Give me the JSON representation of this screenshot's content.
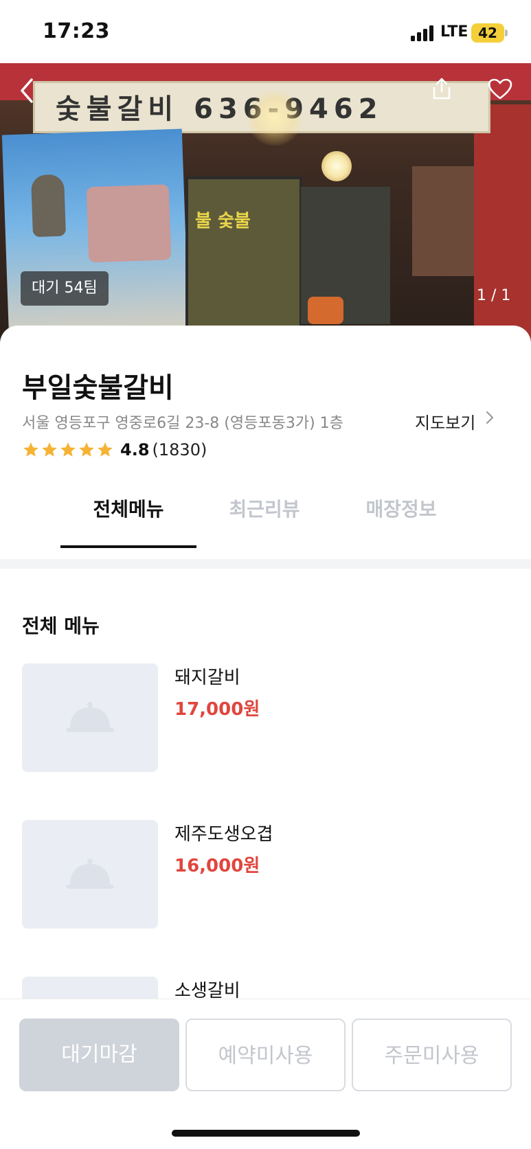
{
  "status_bar": {
    "time": "17:23",
    "network": "LTE",
    "battery": "42"
  },
  "hero": {
    "sign_text": "숯불갈비 636-9462",
    "door_text": "불 숯불",
    "wait_badge": "대기 54팀",
    "photo_count": "1 / 1",
    "icons": [
      "back-icon",
      "share-icon",
      "heart-icon"
    ]
  },
  "store": {
    "name": "부일숯불갈비",
    "address": "서울 영등포구 영중로6길 23-8 (영등포동3가) 1층",
    "map_link": "지도보기",
    "rating": "4.8",
    "review_count": "(1830)",
    "stars": 5
  },
  "tabs": [
    {
      "label": "전체메뉴",
      "active": true
    },
    {
      "label": "최근리뷰",
      "active": false
    },
    {
      "label": "매장정보",
      "active": false
    }
  ],
  "menu": {
    "heading": "전체 메뉴",
    "items": [
      {
        "name": "돼지갈비",
        "price": "17,000원"
      },
      {
        "name": "제주도생오겹",
        "price": "16,000원"
      },
      {
        "name": "소생갈비",
        "price": ""
      }
    ]
  },
  "actions": {
    "wait": "대기마감",
    "reserve": "예약미사용",
    "order": "주문미사용"
  },
  "colors": {
    "price": "#e0463e",
    "star": "#f5b335",
    "disabled_button": "#cfd3da",
    "battery": "#f4cf3a"
  }
}
